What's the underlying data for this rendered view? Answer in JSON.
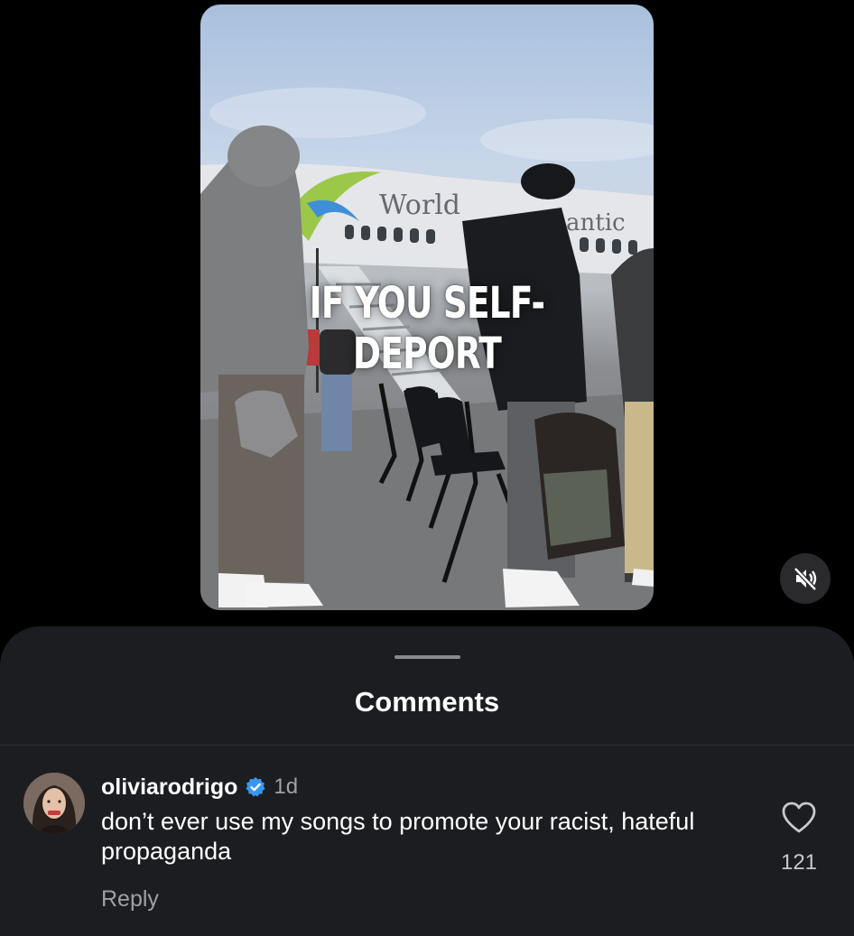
{
  "video": {
    "overlay_text": "IF YOU SELF-DEPORT",
    "airline_text_left": "World",
    "airline_text_right": "antic",
    "mute_icon": "speaker-muted-icon"
  },
  "comments_sheet": {
    "title": "Comments",
    "comments": [
      {
        "username": "oliviarodrigo",
        "verified": true,
        "time": "1d",
        "text": "don’t ever use my songs to promote your racist, hateful propaganda",
        "reply_label": "Reply",
        "like_count": "121"
      }
    ]
  },
  "colors": {
    "sheet_bg": "#1c1d21",
    "verified_blue": "#3897f0",
    "secondary_text": "#a0a0a5"
  }
}
